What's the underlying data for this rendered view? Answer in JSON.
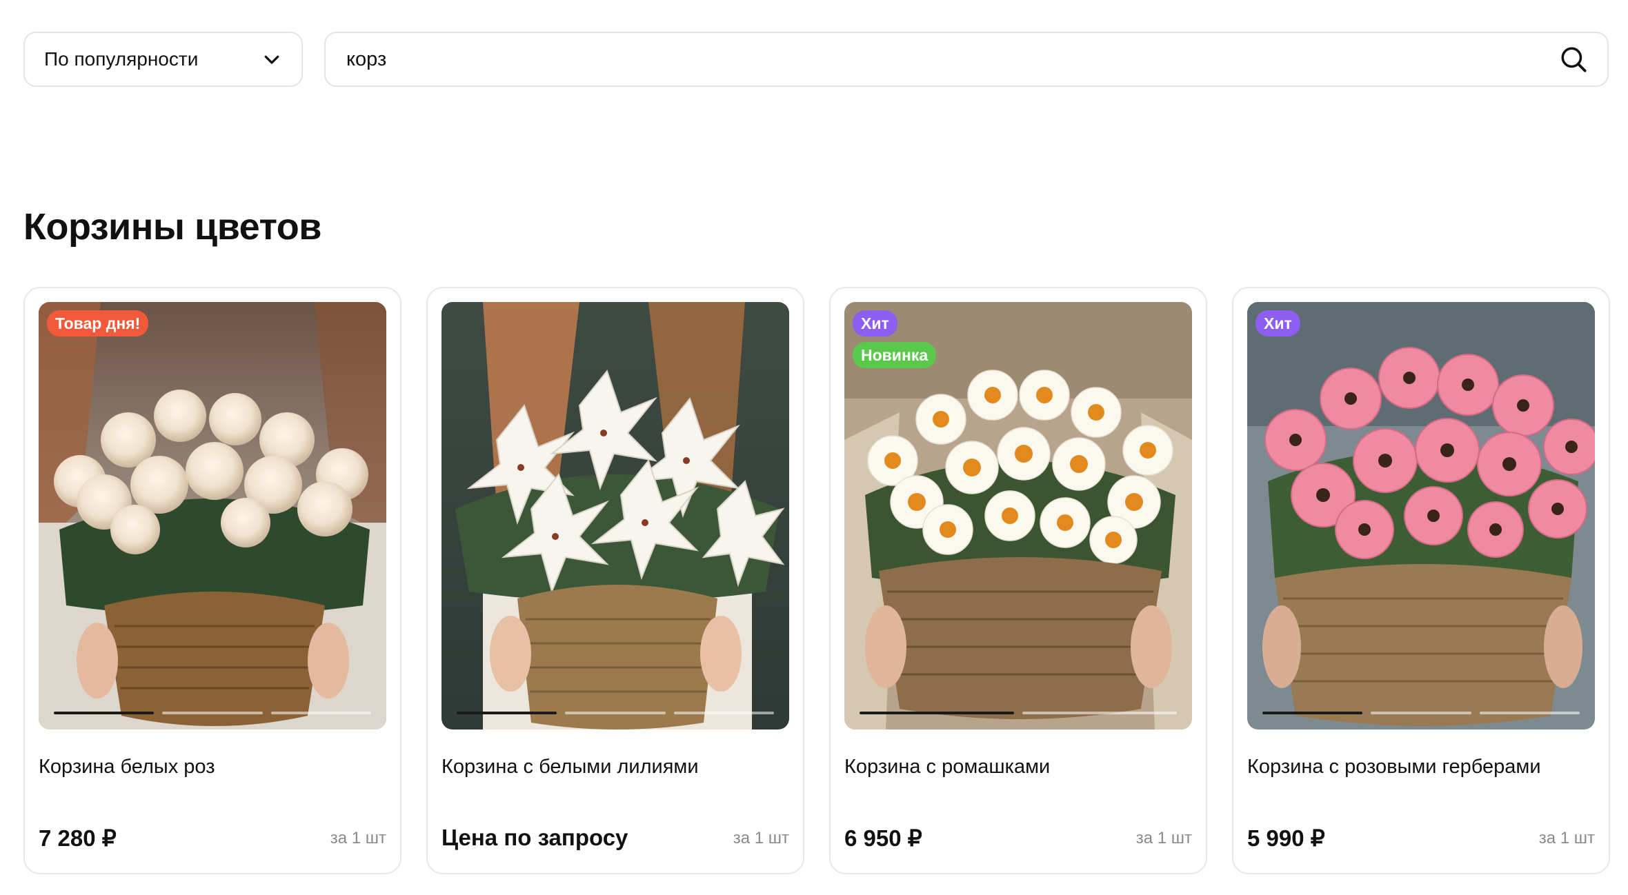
{
  "toolbar": {
    "sort_label": "По популярности",
    "search_value": "корз"
  },
  "section": {
    "title": "Корзины цветов"
  },
  "colors": {
    "badge_day": "#f05a3a",
    "badge_hit": "#8d5ef0",
    "badge_new": "#5ac84a"
  },
  "products": [
    {
      "name": "Корзина белых роз",
      "price": "7 280 ₽",
      "unit": "за 1 шт",
      "badges": [
        {
          "text": "Товар дня!",
          "color": "#f05a3a"
        }
      ],
      "image": "white-roses-basket",
      "slides": 3,
      "active_slide": 0
    },
    {
      "name": "Корзина с белыми лилиями",
      "price": "Цена по запросу",
      "unit": "за 1 шт",
      "badges": [],
      "image": "white-lilies-basket",
      "slides": 3,
      "active_slide": 0
    },
    {
      "name": "Корзина с ромашками",
      "price": "6 950 ₽",
      "unit": "за 1 шт",
      "badges": [
        {
          "text": "Хит",
          "color": "#8d5ef0"
        },
        {
          "text": "Новинка",
          "color": "#5ac84a"
        }
      ],
      "image": "daisies-basket",
      "slides": 2,
      "active_slide": 0
    },
    {
      "name": "Корзина с розовыми герберами",
      "price": "5 990 ₽",
      "unit": "за 1 шт",
      "badges": [
        {
          "text": "Хит",
          "color": "#8d5ef0"
        }
      ],
      "image": "pink-gerberas-basket",
      "slides": 3,
      "active_slide": 0
    }
  ]
}
